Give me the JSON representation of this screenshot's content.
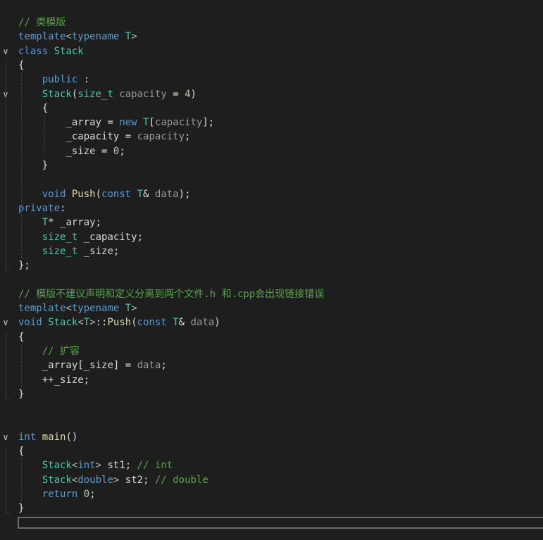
{
  "colors": {
    "background": "#1e1e1e",
    "keyword": "#569cd6",
    "type": "#4ec9b0",
    "function": "#dcdcaa",
    "comment": "#57a64a",
    "number": "#b5cea8",
    "text": "#dcdcdc",
    "identifier": "#dadada",
    "parameter": "#9a9a9a",
    "punctuation": "#b4b4b4"
  },
  "code_lines": [
    [
      {
        "t": "// 类模版",
        "c": "comment"
      }
    ],
    [
      {
        "t": "template",
        "c": "keyword"
      },
      {
        "t": "<",
        "c": "punctuation"
      },
      {
        "t": "typename",
        "c": "keyword"
      },
      {
        "t": " ",
        "c": "text"
      },
      {
        "t": "T",
        "c": "type"
      },
      {
        "t": ">",
        "c": "punctuation"
      }
    ],
    [
      {
        "t": "class",
        "c": "keyword"
      },
      {
        "t": " ",
        "c": "text"
      },
      {
        "t": "Stack",
        "c": "type"
      }
    ],
    [
      {
        "t": "{",
        "c": "text"
      }
    ],
    [
      {
        "t": "    ",
        "c": "text"
      },
      {
        "t": "public",
        "c": "keyword"
      },
      {
        "t": " :",
        "c": "text"
      }
    ],
    [
      {
        "t": "    ",
        "c": "text"
      },
      {
        "t": "Stack",
        "c": "type"
      },
      {
        "t": "(",
        "c": "text"
      },
      {
        "t": "size_t",
        "c": "type"
      },
      {
        "t": " ",
        "c": "text"
      },
      {
        "t": "capacity",
        "c": "parameter"
      },
      {
        "t": " = ",
        "c": "text"
      },
      {
        "t": "4",
        "c": "number"
      },
      {
        "t": ")",
        "c": "text"
      }
    ],
    [
      {
        "t": "    {",
        "c": "text"
      }
    ],
    [
      {
        "t": "        ",
        "c": "text"
      },
      {
        "t": "_array",
        "c": "identifier"
      },
      {
        "t": " = ",
        "c": "text"
      },
      {
        "t": "new",
        "c": "keyword"
      },
      {
        "t": " ",
        "c": "text"
      },
      {
        "t": "T",
        "c": "type"
      },
      {
        "t": "[",
        "c": "text"
      },
      {
        "t": "capacity",
        "c": "parameter"
      },
      {
        "t": "];",
        "c": "text"
      }
    ],
    [
      {
        "t": "        ",
        "c": "text"
      },
      {
        "t": "_capacity",
        "c": "identifier"
      },
      {
        "t": " = ",
        "c": "text"
      },
      {
        "t": "capacity",
        "c": "parameter"
      },
      {
        "t": ";",
        "c": "text"
      }
    ],
    [
      {
        "t": "        ",
        "c": "text"
      },
      {
        "t": "_size",
        "c": "identifier"
      },
      {
        "t": " = ",
        "c": "text"
      },
      {
        "t": "0",
        "c": "number"
      },
      {
        "t": ";",
        "c": "text"
      }
    ],
    [
      {
        "t": "    }",
        "c": "text"
      }
    ],
    [],
    [
      {
        "t": "    ",
        "c": "text"
      },
      {
        "t": "void",
        "c": "keyword"
      },
      {
        "t": " ",
        "c": "text"
      },
      {
        "t": "Push",
        "c": "function"
      },
      {
        "t": "(",
        "c": "text"
      },
      {
        "t": "const",
        "c": "keyword"
      },
      {
        "t": " ",
        "c": "text"
      },
      {
        "t": "T",
        "c": "type"
      },
      {
        "t": "& ",
        "c": "text"
      },
      {
        "t": "data",
        "c": "parameter"
      },
      {
        "t": ");",
        "c": "text"
      }
    ],
    [
      {
        "t": "private",
        "c": "keyword"
      },
      {
        "t": ":",
        "c": "text"
      }
    ],
    [
      {
        "t": "    ",
        "c": "text"
      },
      {
        "t": "T",
        "c": "type"
      },
      {
        "t": "* ",
        "c": "text"
      },
      {
        "t": "_array",
        "c": "identifier"
      },
      {
        "t": ";",
        "c": "text"
      }
    ],
    [
      {
        "t": "    ",
        "c": "text"
      },
      {
        "t": "size_t",
        "c": "type"
      },
      {
        "t": " ",
        "c": "text"
      },
      {
        "t": "_capacity",
        "c": "identifier"
      },
      {
        "t": ";",
        "c": "text"
      }
    ],
    [
      {
        "t": "    ",
        "c": "text"
      },
      {
        "t": "size_t",
        "c": "type"
      },
      {
        "t": " ",
        "c": "text"
      },
      {
        "t": "_size",
        "c": "identifier"
      },
      {
        "t": ";",
        "c": "text"
      }
    ],
    [
      {
        "t": "};",
        "c": "text"
      }
    ],
    [],
    [
      {
        "t": "// 模版不建议声明和定义分离到两个文件.h 和.cpp会出现链接错误",
        "c": "comment"
      }
    ],
    [
      {
        "t": "template",
        "c": "keyword"
      },
      {
        "t": "<",
        "c": "punctuation"
      },
      {
        "t": "typename",
        "c": "keyword"
      },
      {
        "t": " ",
        "c": "text"
      },
      {
        "t": "T",
        "c": "type"
      },
      {
        "t": ">",
        "c": "punctuation"
      }
    ],
    [
      {
        "t": "void",
        "c": "keyword"
      },
      {
        "t": " ",
        "c": "text"
      },
      {
        "t": "Stack",
        "c": "type"
      },
      {
        "t": "<",
        "c": "punctuation"
      },
      {
        "t": "T",
        "c": "type"
      },
      {
        "t": ">",
        "c": "punctuation"
      },
      {
        "t": "::",
        "c": "text"
      },
      {
        "t": "Push",
        "c": "function"
      },
      {
        "t": "(",
        "c": "text"
      },
      {
        "t": "const",
        "c": "keyword"
      },
      {
        "t": " ",
        "c": "text"
      },
      {
        "t": "T",
        "c": "type"
      },
      {
        "t": "& ",
        "c": "text"
      },
      {
        "t": "data",
        "c": "parameter"
      },
      {
        "t": ")",
        "c": "text"
      }
    ],
    [
      {
        "t": "{",
        "c": "text"
      }
    ],
    [
      {
        "t": "    ",
        "c": "text"
      },
      {
        "t": "// 扩容",
        "c": "comment"
      }
    ],
    [
      {
        "t": "    ",
        "c": "text"
      },
      {
        "t": "_array",
        "c": "identifier"
      },
      {
        "t": "[",
        "c": "text"
      },
      {
        "t": "_size",
        "c": "identifier"
      },
      {
        "t": "] = ",
        "c": "text"
      },
      {
        "t": "data",
        "c": "parameter"
      },
      {
        "t": ";",
        "c": "text"
      }
    ],
    [
      {
        "t": "    ++",
        "c": "text"
      },
      {
        "t": "_size",
        "c": "identifier"
      },
      {
        "t": ";",
        "c": "text"
      }
    ],
    [
      {
        "t": "}",
        "c": "text"
      }
    ],
    [],
    [],
    [
      {
        "t": "int",
        "c": "keyword"
      },
      {
        "t": " ",
        "c": "text"
      },
      {
        "t": "main",
        "c": "function"
      },
      {
        "t": "()",
        "c": "text"
      }
    ],
    [
      {
        "t": "{",
        "c": "text"
      }
    ],
    [
      {
        "t": "    ",
        "c": "text"
      },
      {
        "t": "Stack",
        "c": "type"
      },
      {
        "t": "<",
        "c": "punctuation"
      },
      {
        "t": "int",
        "c": "keyword"
      },
      {
        "t": ">",
        "c": "punctuation"
      },
      {
        "t": " ",
        "c": "text"
      },
      {
        "t": "st1",
        "c": "identifier"
      },
      {
        "t": "; ",
        "c": "text"
      },
      {
        "t": "// int",
        "c": "comment"
      }
    ],
    [
      {
        "t": "    ",
        "c": "text"
      },
      {
        "t": "Stack",
        "c": "type"
      },
      {
        "t": "<",
        "c": "punctuation"
      },
      {
        "t": "double",
        "c": "keyword"
      },
      {
        "t": ">",
        "c": "punctuation"
      },
      {
        "t": " ",
        "c": "text"
      },
      {
        "t": "st2",
        "c": "identifier"
      },
      {
        "t": "; ",
        "c": "text"
      },
      {
        "t": "// double",
        "c": "comment"
      }
    ],
    [
      {
        "t": "    ",
        "c": "text"
      },
      {
        "t": "return",
        "c": "keyword"
      },
      {
        "t": " ",
        "c": "text"
      },
      {
        "t": "0",
        "c": "number"
      },
      {
        "t": ";",
        "c": "text"
      }
    ],
    [
      {
        "t": "}",
        "c": "text"
      }
    ]
  ],
  "fold_markers": [
    {
      "line": 2,
      "icon": "chevron-down-icon",
      "glyph": "∨"
    },
    {
      "line": 5,
      "icon": "chevron-down-icon",
      "glyph": "∨"
    },
    {
      "line": 21,
      "icon": "chevron-down-icon",
      "glyph": "∨"
    },
    {
      "line": 29,
      "icon": "chevron-down-icon",
      "glyph": "∨"
    }
  ]
}
